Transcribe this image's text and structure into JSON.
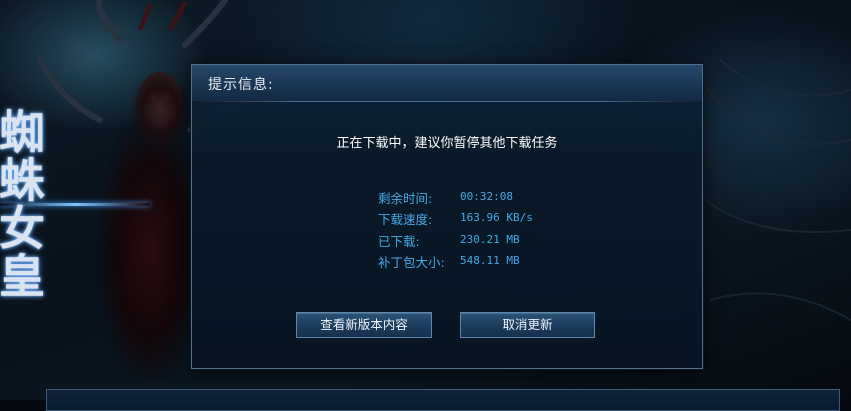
{
  "background": {
    "title_art": "蜘蛛女皇"
  },
  "dialog": {
    "title": "提示信息:",
    "message": "正在下载中，建议你暂停其他下载任务",
    "stats": [
      {
        "label": "剩余时间:",
        "value": "00:32:08"
      },
      {
        "label": "下载速度:",
        "value": "163.96 KB/s"
      },
      {
        "label": "已下载:",
        "value": "230.21 MB"
      },
      {
        "label": "补丁包大小:",
        "value": "548.11 MB"
      }
    ],
    "buttons": {
      "view_content": "查看新版本内容",
      "cancel_update": "取消更新"
    }
  },
  "colors": {
    "accent_text": "#47a8e8",
    "dialog_bg": "#0a1a2c",
    "button_bg": "#1c3d5e",
    "button_border": "#5d87ad"
  }
}
